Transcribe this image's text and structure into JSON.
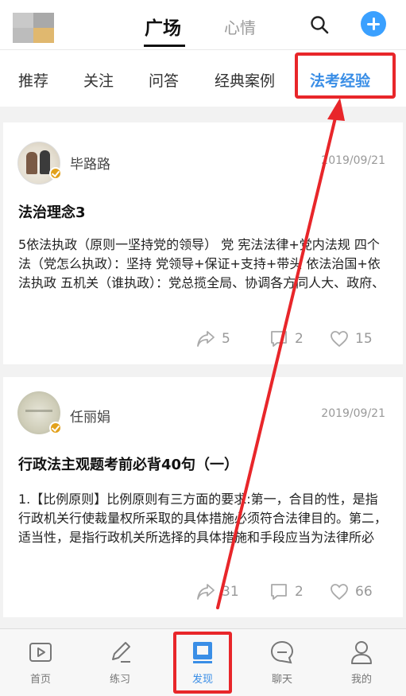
{
  "header": {
    "tabs": [
      {
        "label": "广场",
        "active": true
      },
      {
        "label": "心情",
        "active": false
      }
    ]
  },
  "categories": [
    {
      "label": "推荐"
    },
    {
      "label": "关注"
    },
    {
      "label": "问答"
    },
    {
      "label": "经典案例"
    },
    {
      "label": "法考经验",
      "active": true
    }
  ],
  "posts": [
    {
      "author": "毕路路",
      "date": "2019/09/21",
      "title": "法治理念3",
      "body": "5依法执政（原则一坚持党的领导） 党 宪法法律+党内法规 四个法（党怎么执政）：坚持 党领导+保证+支持+带头 依法治国+依法执政 五机关（谁执政）：党总揽全局、协调各方同人大、政府、政协...",
      "shares": "5",
      "comments": "2",
      "likes": "15"
    },
    {
      "author": "任丽娟",
      "date": "2019/09/21",
      "title": "行政法主观题考前必背40句（一）",
      "body": "1.【比例原则】比例原则有三方面的要求:第一，合目的性，是指行政机关行使裁量权所采取的具体措施必须符合法律目的。第二，适当性，是指行政机关所选择的具体措施和手段应当为法律所必需，结果与...",
      "shares": "31",
      "comments": "2",
      "likes": "66"
    }
  ],
  "tabbar": {
    "items": [
      {
        "label": "首页",
        "icon": "home-icon"
      },
      {
        "label": "练习",
        "icon": "pencil-icon"
      },
      {
        "label": "发现",
        "icon": "discover-icon",
        "active": true
      },
      {
        "label": "聊天",
        "icon": "chat-icon"
      },
      {
        "label": "我的",
        "icon": "profile-icon"
      }
    ]
  },
  "colors": {
    "accent": "#3a8ee6",
    "annotation": "#e8262a",
    "plus": "#3aa0ff",
    "badge": "#e2a11b"
  }
}
